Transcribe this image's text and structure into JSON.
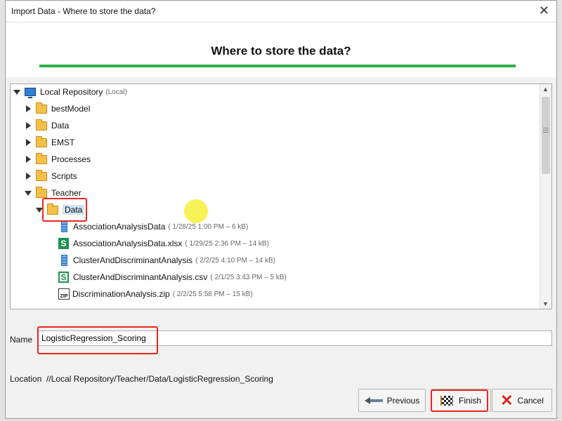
{
  "window": {
    "title": "Import Data - Where to store the data?",
    "close_glyph": "✕"
  },
  "header": {
    "heading": "Where to store the data?"
  },
  "tree": {
    "root": {
      "label": "Local Repository",
      "meta": "(Local)"
    },
    "folders": [
      "bestModel",
      "Data",
      "EMST",
      "Processes",
      "Scripts"
    ],
    "teacher": "Teacher",
    "selected_folder": "Data",
    "files": [
      {
        "label": "AssociationAnalysisData",
        "meta": "( 1/28/25 1:00 PM – 6 kB)",
        "icon": "database-icon"
      },
      {
        "label": "AssociationAnalysisData.xlsx",
        "meta": "( 1/29/25 2:36 PM – 14 kB)",
        "icon": "spreadsheet-icon"
      },
      {
        "label": "ClusterAndDiscriminantAnalysis",
        "meta": "( 2/2/25 4:10 PM – 14 kB)",
        "icon": "database-icon"
      },
      {
        "label": "ClusterAndDiscriminantAnalysis.csv",
        "meta": "( 2/1/25 3:43 PM – 5 kB)",
        "icon": "csv-icon"
      },
      {
        "label": "DiscriminationAnalysis.zip",
        "meta": "( 2/2/25 5:58 PM – 15 kB)",
        "icon": "zip-icon"
      }
    ]
  },
  "name_field": {
    "label": "Name",
    "value": "LogisticRegression_Scoring"
  },
  "location": {
    "label": "Location",
    "value": "//Local Repository/Teacher/Data/LogisticRegression_Scoring"
  },
  "buttons": {
    "previous": "Previous",
    "finish": "Finish",
    "cancel": "Cancel"
  }
}
